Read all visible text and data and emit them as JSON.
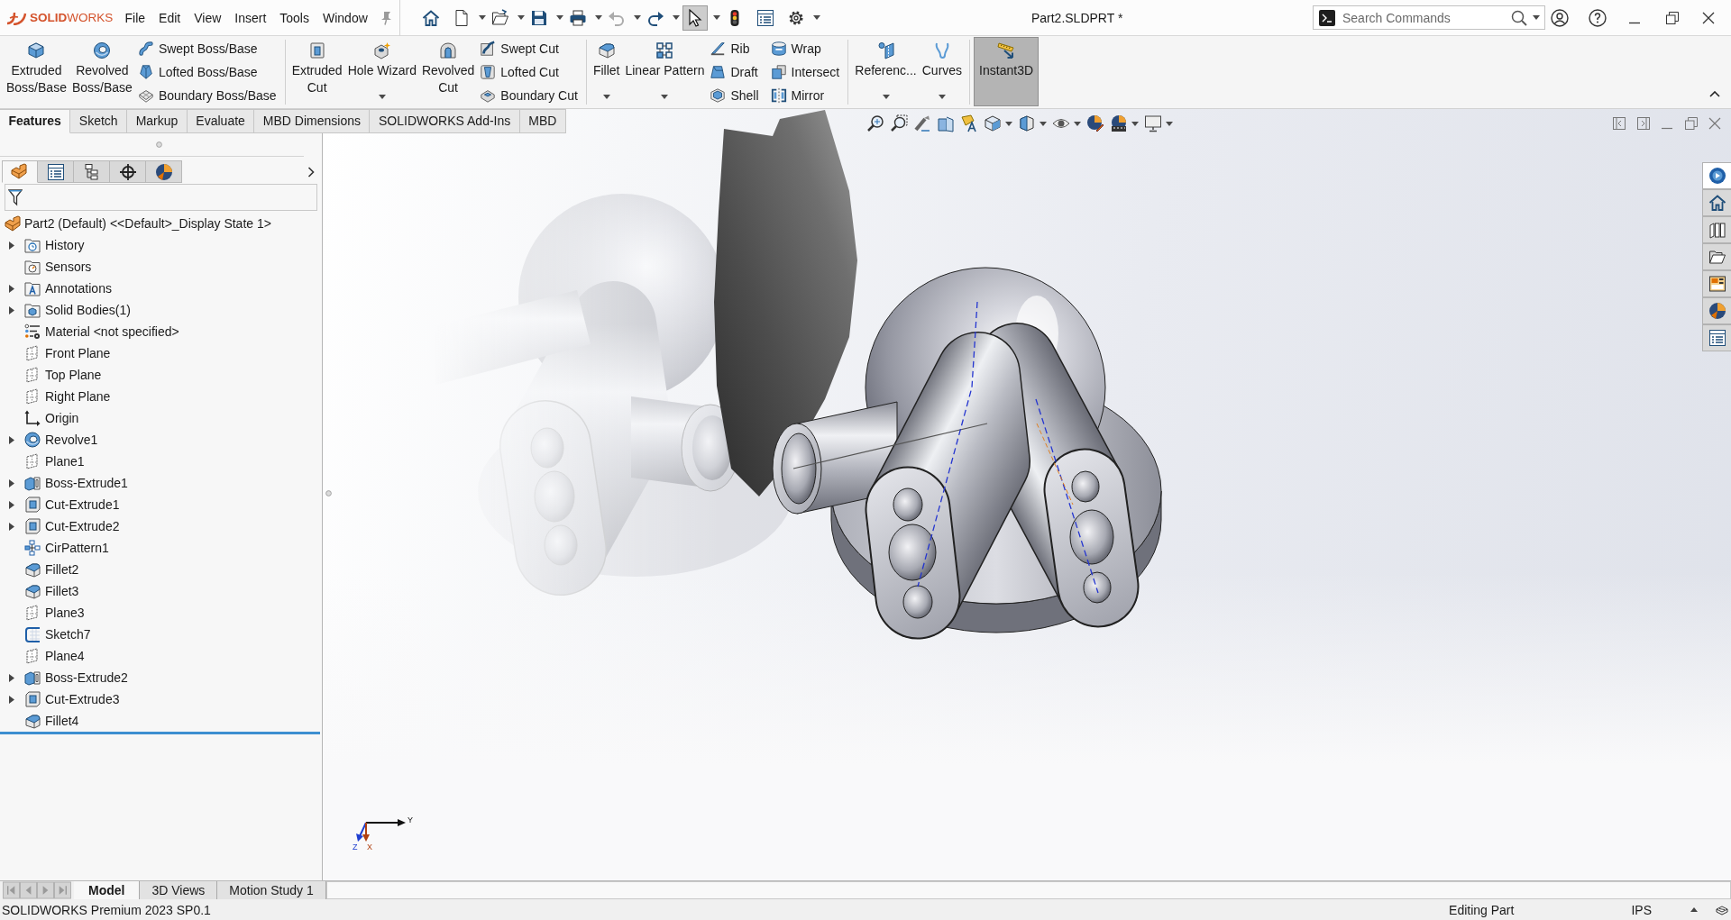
{
  "title_bar": {
    "logo": "**SOLID**WORKS",
    "menus": [
      "File",
      "Edit",
      "View",
      "Insert",
      "Tools",
      "Window"
    ],
    "quick_access": [
      {
        "kind": "home",
        "dropdown": false,
        "disabled": false,
        "pressed": false
      },
      {
        "kind": "new",
        "dropdown": true,
        "disabled": false,
        "pressed": false
      },
      {
        "kind": "open",
        "dropdown": true,
        "disabled": false,
        "pressed": false
      },
      {
        "kind": "save",
        "dropdown": true,
        "disabled": false,
        "pressed": false
      },
      {
        "kind": "print",
        "dropdown": true,
        "disabled": false,
        "pressed": false
      },
      {
        "kind": "undo",
        "dropdown": true,
        "disabled": true,
        "pressed": false
      },
      {
        "kind": "redo",
        "dropdown": true,
        "disabled": false,
        "pressed": false
      },
      {
        "kind": "select",
        "dropdown": true,
        "disabled": false,
        "pressed": true
      },
      {
        "kind": "rebuild",
        "dropdown": false,
        "disabled": false,
        "pressed": false
      },
      {
        "kind": "properties",
        "dropdown": false,
        "disabled": false,
        "pressed": false
      },
      {
        "kind": "options",
        "dropdown": true,
        "disabled": false,
        "pressed": false
      }
    ],
    "document_title": "Part2.SLDPRT *",
    "search": {
      "placeholder": "Search Commands"
    }
  },
  "ribbon": {
    "groups": [
      {
        "large": [
          {
            "kind": "extrude",
            "label_lines": [
              "Extruded",
              "Boss/Base"
            ],
            "dropdown": false,
            "active": false
          },
          {
            "kind": "revolve",
            "label_lines": [
              "Revolved",
              "Boss/Base"
            ],
            "dropdown": false,
            "active": false
          }
        ],
        "stacks": [
          [
            {
              "kind": "sweep",
              "label": "Swept Boss/Base"
            },
            {
              "kind": "loft",
              "label": "Lofted Boss/Base"
            },
            {
              "kind": "boundary",
              "label": "Boundary Boss/Base"
            }
          ]
        ]
      },
      {
        "large": [
          {
            "kind": "extrudecut",
            "label_lines": [
              "Extruded",
              "Cut"
            ],
            "dropdown": false,
            "active": false
          },
          {
            "kind": "holewizard",
            "label_lines": [
              "Hole Wizard"
            ],
            "dropdown": true,
            "active": false
          },
          {
            "kind": "revolvecut",
            "label_lines": [
              "Revolved",
              "Cut"
            ],
            "dropdown": false,
            "active": false
          }
        ],
        "stacks": [
          [
            {
              "kind": "sweptcut",
              "label": "Swept Cut"
            },
            {
              "kind": "loftedcut",
              "label": "Lofted Cut"
            },
            {
              "kind": "boundarycut",
              "label": "Boundary Cut"
            }
          ]
        ]
      },
      {
        "large": [
          {
            "kind": "fillet",
            "label_lines": [
              "Fillet"
            ],
            "dropdown": true,
            "active": false
          },
          {
            "kind": "pattern",
            "label_lines": [
              "Linear Pattern"
            ],
            "dropdown": true,
            "active": false
          }
        ],
        "stacks": [
          [
            {
              "kind": "rib",
              "label": "Rib"
            },
            {
              "kind": "draft",
              "label": "Draft"
            },
            {
              "kind": "shell",
              "label": "Shell"
            }
          ],
          [
            {
              "kind": "wrap",
              "label": "Wrap"
            },
            {
              "kind": "intersect",
              "label": "Intersect"
            },
            {
              "kind": "mirror",
              "label": "Mirror"
            }
          ]
        ]
      },
      {
        "large": [
          {
            "kind": "reference",
            "label_lines": [
              "Referenc..."
            ],
            "dropdown": true,
            "active": false
          },
          {
            "kind": "curves",
            "label_lines": [
              "Curves"
            ],
            "dropdown": true,
            "active": false
          }
        ]
      },
      {
        "large": [
          {
            "kind": "instant3d",
            "label_lines": [
              "Instant3D"
            ],
            "dropdown": false,
            "active": true
          }
        ]
      }
    ],
    "tabs": [
      {
        "label": "Features",
        "selected": true
      },
      {
        "label": "Sketch",
        "selected": false
      },
      {
        "label": "Markup",
        "selected": false
      },
      {
        "label": "Evaluate",
        "selected": false
      },
      {
        "label": "MBD Dimensions",
        "selected": false
      },
      {
        "label": "SOLIDWORKS Add-Ins",
        "selected": false
      },
      {
        "label": "MBD",
        "selected": false
      }
    ]
  },
  "feature_manager": {
    "tabs": [
      {
        "kind": "tree",
        "selected": true
      },
      {
        "kind": "properties",
        "selected": false
      },
      {
        "kind": "configurations",
        "selected": false
      },
      {
        "kind": "dimxpert",
        "selected": false
      },
      {
        "kind": "display",
        "selected": false
      }
    ],
    "tree": {
      "label": "Part2 (Default) <<Default>_Display State 1>",
      "kind": "part",
      "expandable": false,
      "children": [
        {
          "label": "History",
          "kind": "history",
          "expandable": true
        },
        {
          "label": "Sensors",
          "kind": "sensors",
          "expandable": false
        },
        {
          "label": "Annotations",
          "kind": "annotations",
          "expandable": true
        },
        {
          "label": "Solid Bodies(1)",
          "kind": "bodies",
          "expandable": true
        },
        {
          "label": "Material <not specified>",
          "kind": "material",
          "expandable": false
        },
        {
          "label": "Front Plane",
          "kind": "plane",
          "expandable": false
        },
        {
          "label": "Top Plane",
          "kind": "plane",
          "expandable": false
        },
        {
          "label": "Right Plane",
          "kind": "plane",
          "expandable": false
        },
        {
          "label": "Origin",
          "kind": "origin",
          "expandable": false
        },
        {
          "label": "Revolve1",
          "kind": "revolve",
          "expandable": true
        },
        {
          "label": "Plane1",
          "kind": "plane",
          "expandable": false
        },
        {
          "label": "Boss-Extrude1",
          "kind": "boss",
          "expandable": true
        },
        {
          "label": "Cut-Extrude1",
          "kind": "cut",
          "expandable": true
        },
        {
          "label": "Cut-Extrude2",
          "kind": "cut",
          "expandable": true
        },
        {
          "label": "CirPattern1",
          "kind": "pattern",
          "expandable": false
        },
        {
          "label": "Fillet2",
          "kind": "fillet",
          "expandable": false
        },
        {
          "label": "Fillet3",
          "kind": "fillet",
          "expandable": false
        },
        {
          "label": "Plane3",
          "kind": "plane",
          "expandable": false
        },
        {
          "label": "Sketch7",
          "kind": "sketch",
          "expandable": false
        },
        {
          "label": "Plane4",
          "kind": "plane",
          "expandable": false
        },
        {
          "label": "Boss-Extrude2",
          "kind": "boss",
          "expandable": true
        },
        {
          "label": "Cut-Extrude3",
          "kind": "cut",
          "expandable": true
        },
        {
          "label": "Fillet4",
          "kind": "fillet",
          "expandable": false
        }
      ]
    }
  },
  "viewport": {
    "task_pane": [
      {
        "kind": "resources",
        "selected": true
      },
      {
        "kind": "home",
        "selected": false
      },
      {
        "kind": "library",
        "selected": false
      },
      {
        "kind": "explorer",
        "selected": false
      },
      {
        "kind": "palette",
        "selected": false
      },
      {
        "kind": "appearances",
        "selected": false
      },
      {
        "kind": "properties",
        "selected": false
      }
    ],
    "triad": {
      "x": "X",
      "y": "Y",
      "z": "Z"
    }
  },
  "bottom_tabs": [
    {
      "label": "Model",
      "selected": true
    },
    {
      "label": "3D Views",
      "selected": false
    },
    {
      "label": "Motion Study 1",
      "selected": false
    }
  ],
  "status_bar": {
    "product": "SOLIDWORKS Premium 2023 SP0.1",
    "mode": "Editing Part",
    "units": "IPS"
  }
}
